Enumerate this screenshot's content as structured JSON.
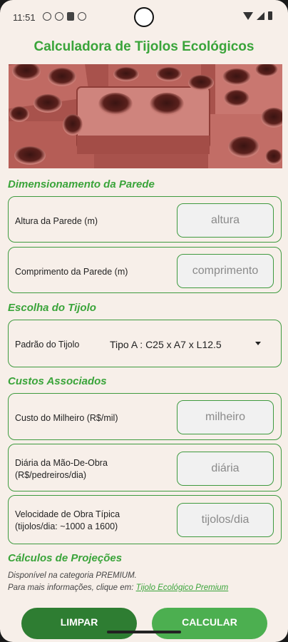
{
  "status_bar": {
    "time": "11:51"
  },
  "app": {
    "title": "Calculadora de Tijolos Ecológicos"
  },
  "sections": {
    "wall": "Dimensionamento da Parede",
    "brick": "Escolha do Tijolo",
    "costs": "Custos Associados",
    "projections": "Cálculos de Projeções"
  },
  "wall": {
    "height_label": "Altura da Parede (m)",
    "height_placeholder": "altura",
    "length_label": "Comprimento da Parede (m)",
    "length_placeholder": "comprimento"
  },
  "brick": {
    "label": "Padrão do Tijolo",
    "selected": "Tipo A : C25 x A7  x L12.5"
  },
  "costs": {
    "thousand_label": "Custo do Milheiro (R$/mil)",
    "thousand_placeholder": "milheiro",
    "daily_label_1": "Diária da Mão-De-Obra",
    "daily_label_2": "(R$/pedreiros/dia)",
    "daily_placeholder": "diária",
    "speed_label_1": "Velocidade de Obra Típica",
    "speed_label_2": "(tijolos/dia: ~1000 a 1600)",
    "speed_placeholder": "tijolos/dia"
  },
  "projections": {
    "line1": "Disponível na categoria PREMIUM.",
    "line2": "Para mais informações, clique em:",
    "link": "Tijolo Ecológico Premium"
  },
  "buttons": {
    "clear": "LIMPAR",
    "calculate": "CALCULAR"
  },
  "colors": {
    "accent": "#3aa43a",
    "button_dark": "#2e7d32",
    "button_light": "#4caf50",
    "background": "#f7efe9"
  },
  "icons": [
    "wifi-icon",
    "signal-icon",
    "battery-icon",
    "dropdown-arrow-icon"
  ]
}
